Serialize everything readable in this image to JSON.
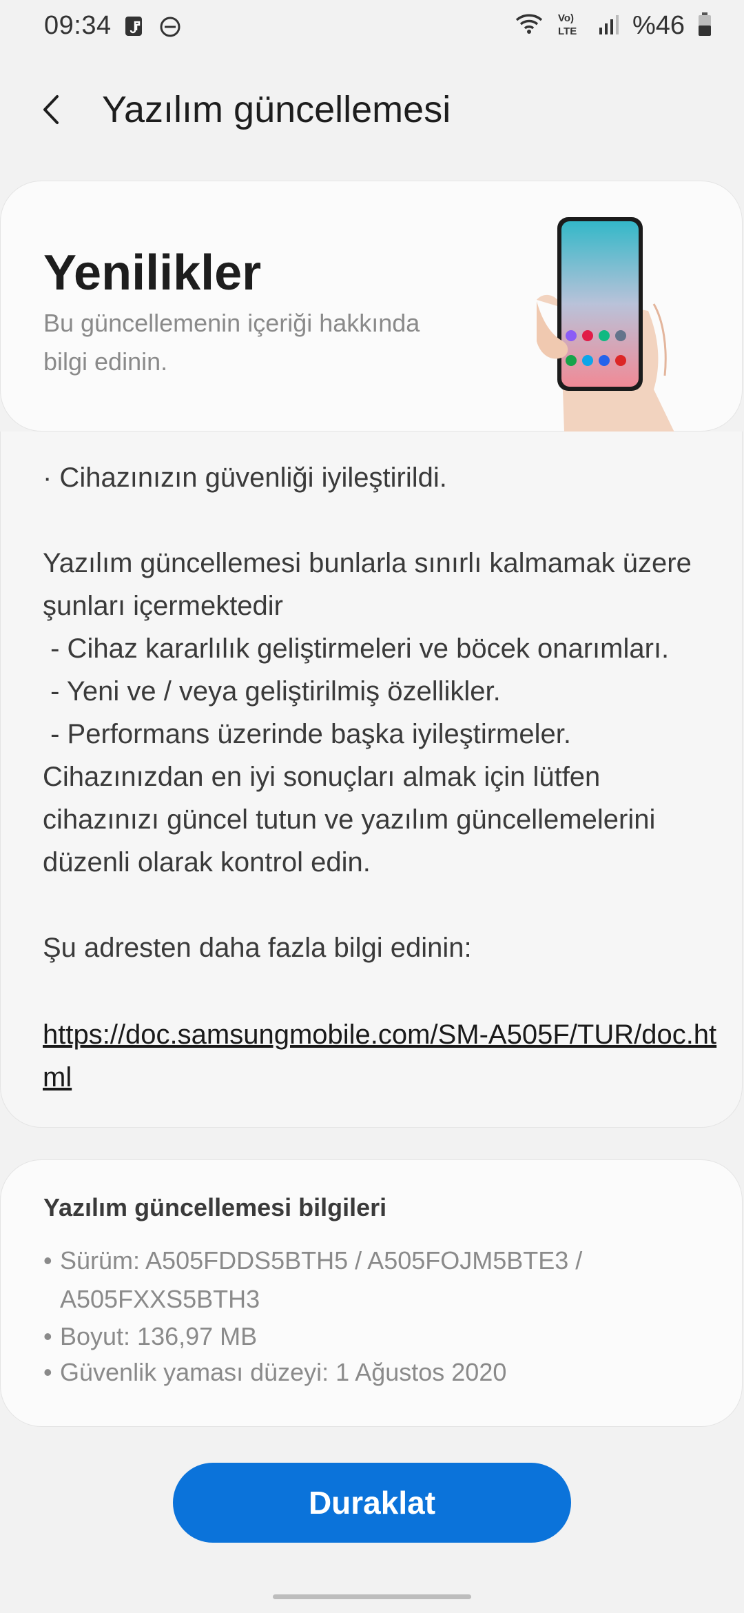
{
  "status_bar": {
    "time": "09:34",
    "battery": "%46",
    "icons": {
      "left": [
        "music-note-icon",
        "do-not-disturb-icon"
      ],
      "right": [
        "wifi-icon",
        "volte-lte-icon",
        "signal-icon",
        "battery-icon"
      ]
    },
    "volte_lines": [
      "Vo)",
      "LTE"
    ]
  },
  "header": {
    "title": "Yazılım güncellemesi",
    "back_icon": "back-chevron-icon"
  },
  "hero": {
    "title": "Yenilikler",
    "subtitle": "Bu güncellemenin içeriği hakkında bilgi edinin.",
    "illustration": "phone-in-hand-illustration"
  },
  "notes": {
    "body": "· Cihazınızın güvenliği iyileştirildi.\n\nYazılım güncellemesi bunlarla sınırlı kalmamak üzere şunları içermektedir\n - Cihaz kararlılık geliştirmeleri ve böcek onarımları.\n - Yeni ve / veya geliştirilmiş özellikler.\n - Performans üzerinde başka iyileştirmeler.\nCihazınızdan en iyi sonuçları almak için lütfen cihazınızı güncel tutun ve yazılım güncellemelerini düzenli olarak kontrol edin.\n\nŞu adresten daha fazla bilgi edinin:",
    "link": "https://doc.samsungmobile.com/SM-A505F/TUR/doc.html"
  },
  "info": {
    "title": "Yazılım güncellemesi bilgileri",
    "items": [
      "Sürüm: A505FDDS5BTH5 / A505FOJM5BTE3 / A505FXXS5BTH3",
      "Boyut: 136,97 MB",
      "Güvenlik yaması düzeyi: 1 Ağustos 2020"
    ]
  },
  "actions": {
    "pause_label": "Duraklat"
  },
  "colors": {
    "primary": "#0b73da",
    "background": "#f2f2f2",
    "card": "#fbfbfb",
    "muted_text": "#8a8a8a"
  }
}
